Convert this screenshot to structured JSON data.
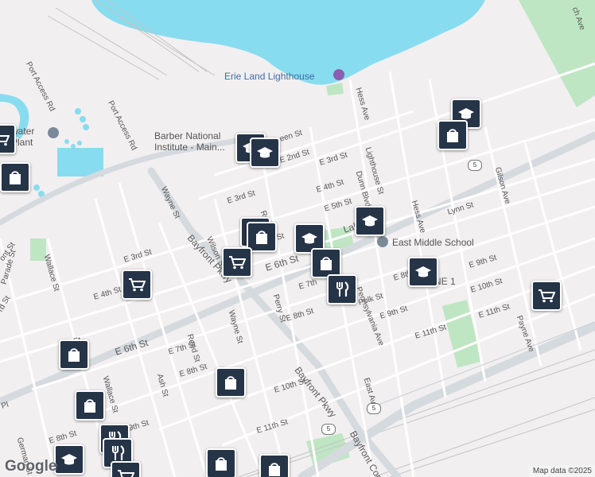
{
  "map": {
    "colors": {
      "land": "#f2eff0",
      "water": "#88dcef",
      "park": "#bfe6c3",
      "road": "#ffffff",
      "highway": "#d4d9de",
      "rail": "#b9b9b9",
      "pin": "#263448"
    },
    "pois": {
      "lighthouse": "Erie Land Lighthouse",
      "barber_line1": "Barber National",
      "barber_line2": "Institute - Main...",
      "east_middle": "East Middle School",
      "water_plant_a": "water",
      "water_plant_b": "Plant"
    },
    "streets": {
      "port_access_a": "Port Access Rd",
      "port_access_b": "Port Access Rd",
      "hess_ave_a": "Hess Ave",
      "hess_ave_b": "Hess Ave",
      "lighthouse_st": "Lighthouse St",
      "dunn_blvd": "Dunn Blvd",
      "gilson_ave": "Gilson Ave",
      "lynn_st": "Lynn St",
      "e_3rd_a": "E 3rd St",
      "e_3rd_b": "E 3rd St",
      "e_3rd_c": "E 3rd St",
      "e_4th_a": "E 4th St",
      "e_4th_b": "E 4th St",
      "e_5th": "E 5th St",
      "e_2nd": "E 2nd St",
      "e_6th_a": "E 6th St",
      "e_6th_b": "E 6th St",
      "e_7th_a": "E 7th St",
      "e_7th_b": "E 7th St",
      "e_8th_a": "E 8th St",
      "e_8th_b": "E 8th St",
      "e_8th_c": "E 8th St",
      "e_8th_d": "E 8th",
      "e_9th_a": "E 9th St",
      "e_9th_b": "E 9th St",
      "e_9th_c": "9th St",
      "e_10th_a": "E 10th St",
      "e_10th_b": "E 10th St",
      "e_11th_a": "E 11th St",
      "e_11th_b": "E 11th St",
      "e_11th_c": "E 11th St",
      "wayne_a": "Wayne St",
      "wayne_b": "Wayne St",
      "wilson": "Wilson St",
      "ross": "Ross St",
      "perry": "Perry St",
      "reed": "Reed St",
      "ash": "Ash St",
      "wallace_a": "Wallace St",
      "wallace_b": "Wallace St",
      "parade": "Parade St",
      "german": "German St",
      "bayfront_a": "Bayfront Pkwy",
      "bayfront_b": "Bayfront Pkwy",
      "bayfront_conn": "Bayfront Conn",
      "pennsylvania": "Pennsylvania Ave",
      "east_ave": "East Ave",
      "payne": "Payne Ave",
      "polk": "Polk St",
      "lake_rd": "Lake R",
      "queen": "een St",
      "rd_frag": "rd St",
      "ont_frag": "ont St",
      "pl_frag": "Pl",
      "tth_frag": "th St",
      "ach_frag": "ch Ave",
      "ne1": "NE 1",
      "st_frag": "St",
      "e_7th_frag": "E 7th"
    },
    "route": "5",
    "google_logo": "Google",
    "attribution": "Map data ©2025",
    "markers": [
      {
        "id": "school-1",
        "icon": "school-icon"
      },
      {
        "id": "school-2",
        "icon": "school-icon"
      },
      {
        "id": "shopping-1",
        "icon": "shopping-bag-icon"
      },
      {
        "id": "school-3",
        "icon": "school-icon"
      },
      {
        "id": "school-4",
        "icon": "school-icon"
      },
      {
        "id": "shopping-2",
        "icon": "shopping-bag-icon"
      },
      {
        "id": "shopping-3",
        "icon": "shopping-bag-icon"
      },
      {
        "id": "cart-1",
        "icon": "shopping-cart-icon"
      },
      {
        "id": "shopping-4",
        "icon": "shopping-bag-icon"
      },
      {
        "id": "shopping-5",
        "icon": "shopping-bag-icon"
      },
      {
        "id": "cart-2",
        "icon": "shopping-cart-icon"
      },
      {
        "id": "school-5",
        "icon": "school-icon"
      },
      {
        "id": "school-6",
        "icon": "school-icon"
      },
      {
        "id": "shopping-6",
        "icon": "shopping-bag-icon"
      },
      {
        "id": "restaurant-1",
        "icon": "restaurant-icon"
      },
      {
        "id": "school-7",
        "icon": "school-icon"
      },
      {
        "id": "cart-3",
        "icon": "shopping-cart-icon"
      },
      {
        "id": "shopping-7",
        "icon": "shopping-bag-icon"
      },
      {
        "id": "shopping-8",
        "icon": "shopping-bag-icon"
      },
      {
        "id": "shopping-9",
        "icon": "shopping-bag-icon"
      },
      {
        "id": "shopping-10",
        "icon": "shopping-bag-icon"
      },
      {
        "id": "restaurant-2",
        "icon": "restaurant-icon"
      },
      {
        "id": "restaurant-3",
        "icon": "restaurant-icon"
      },
      {
        "id": "school-8",
        "icon": "school-icon"
      },
      {
        "id": "shopping-11",
        "icon": "shopping-bag-icon"
      },
      {
        "id": "shopping-12",
        "icon": "shopping-bag-icon"
      },
      {
        "id": "cart-4",
        "icon": "shopping-cart-icon"
      }
    ]
  }
}
